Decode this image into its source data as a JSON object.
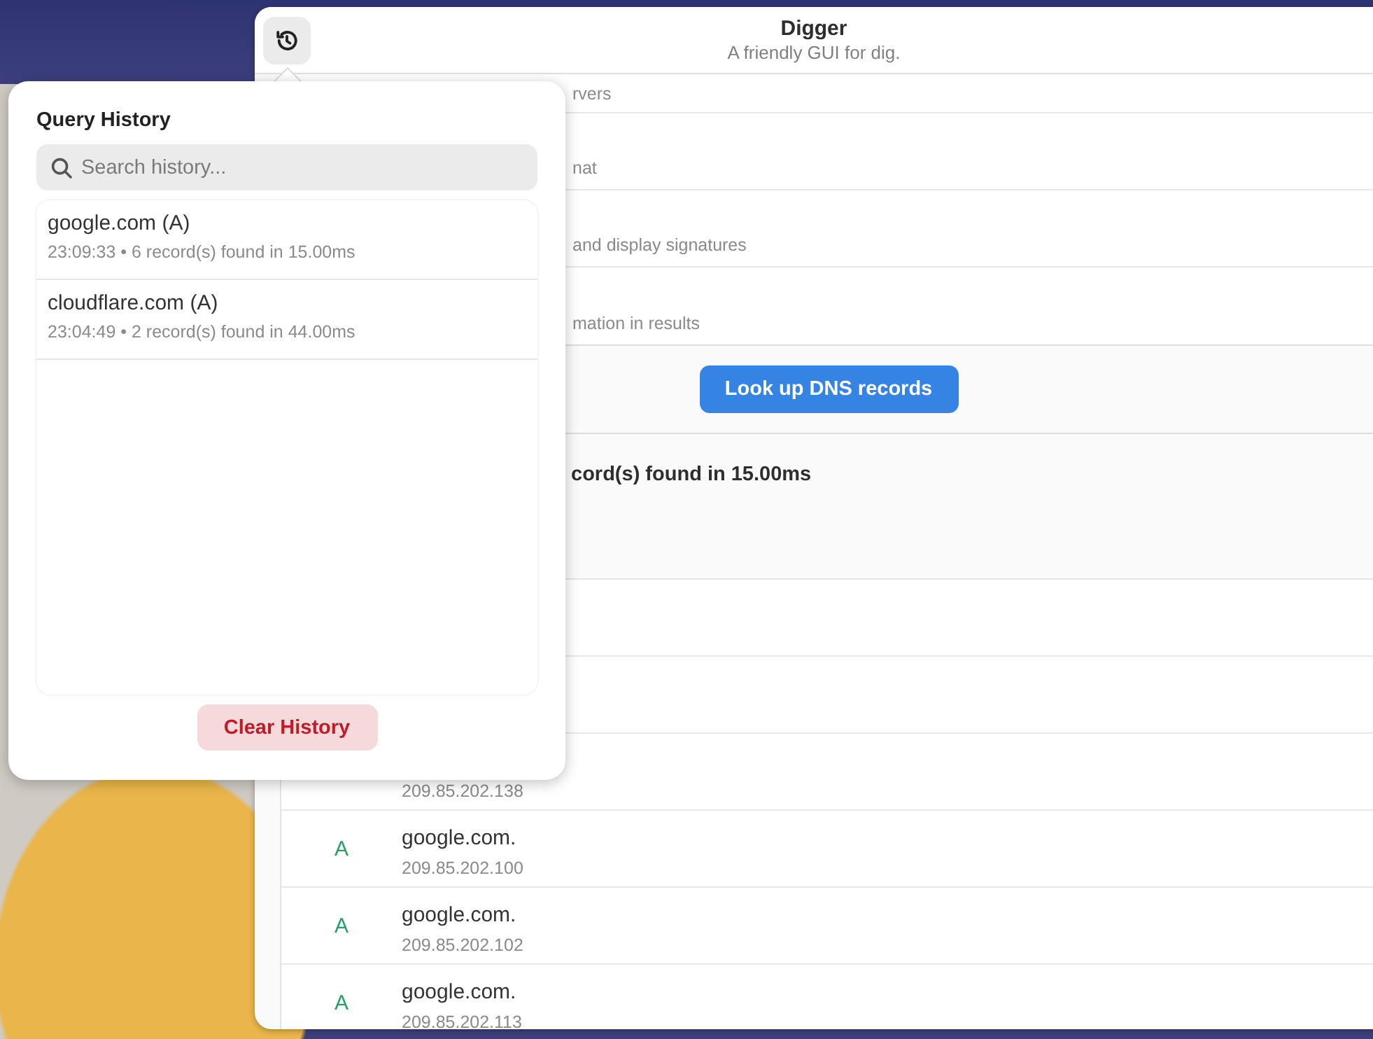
{
  "window": {
    "title": "Digger",
    "subtitle": "A friendly GUI for dig."
  },
  "settings_rows": [
    {
      "description": "rvers"
    },
    {
      "description": "nat"
    },
    {
      "description": "and display signatures"
    },
    {
      "description": "mation in results"
    }
  ],
  "lookup_button": "Look up DNS records",
  "results": {
    "summary": "cord(s) found in 15.00ms",
    "records": [
      {
        "address": "209.85.202.138"
      },
      {
        "type": "A",
        "name": "google.com.",
        "address": "209.85.202.100"
      },
      {
        "type": "A",
        "name": "google.com.",
        "address": "209.85.202.102"
      },
      {
        "type": "A",
        "name": "google.com.",
        "address": "209.85.202.113"
      }
    ]
  },
  "history_popover": {
    "title": "Query History",
    "search": {
      "placeholder": "Search history..."
    },
    "items": [
      {
        "query": "google.com (A)",
        "details": "23:09:33 • 6 record(s) found in 15.00ms"
      },
      {
        "query": "cloudflare.com (A)",
        "details": "23:04:49 • 2 record(s) found in 44.00ms"
      }
    ],
    "clear_button": "Clear History"
  }
}
